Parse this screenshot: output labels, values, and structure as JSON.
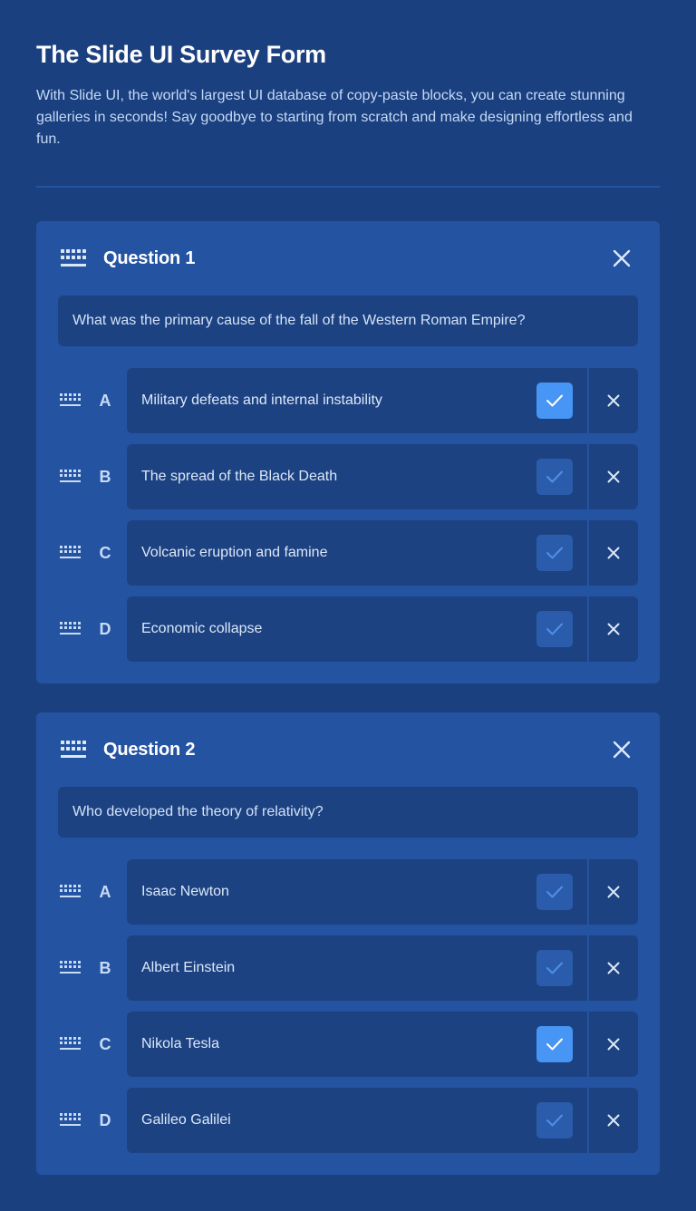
{
  "header": {
    "title": "The Slide UI Survey Form",
    "description": "With Slide UI, the world's largest UI database of copy-paste blocks, you can create stunning galleries in seconds! Say goodbye to starting from scratch and make designing effortless and fun."
  },
  "colors": {
    "background": "#1b4080",
    "card": "#2453a2",
    "field": "#1c4282",
    "check_active": "#4795f5",
    "check_inactive": "#2a5cab"
  },
  "icons": {
    "drag": "drag-handle-icon",
    "close": "close-icon",
    "check": "check-icon",
    "remove": "remove-icon"
  },
  "questions": [
    {
      "title": "Question 1",
      "text": "What was the primary cause of the fall of the Western Roman Empire?",
      "options": [
        {
          "letter": "A",
          "text": "Military defeats and internal instability",
          "selected": true
        },
        {
          "letter": "B",
          "text": "The spread of the Black Death",
          "selected": false
        },
        {
          "letter": "C",
          "text": "Volcanic eruption and famine",
          "selected": false
        },
        {
          "letter": "D",
          "text": "Economic collapse",
          "selected": false
        }
      ]
    },
    {
      "title": "Question 2",
      "text": "Who developed the theory of relativity?",
      "options": [
        {
          "letter": "A",
          "text": "Isaac Newton",
          "selected": false
        },
        {
          "letter": "B",
          "text": "Albert Einstein",
          "selected": false
        },
        {
          "letter": "C",
          "text": "Nikola Tesla",
          "selected": true
        },
        {
          "letter": "D",
          "text": "Galileo Galilei",
          "selected": false
        }
      ]
    }
  ]
}
